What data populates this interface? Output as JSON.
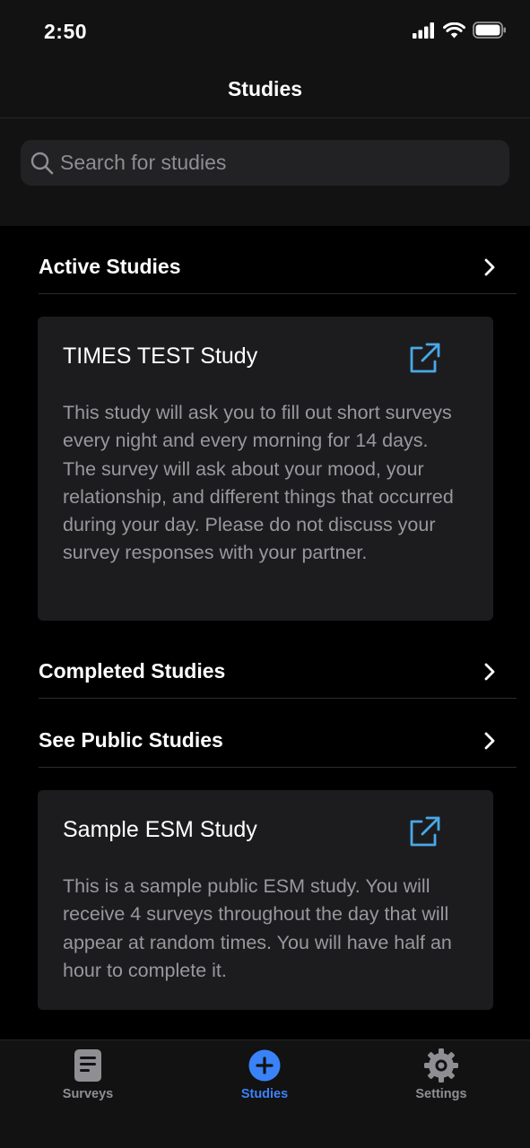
{
  "status_bar": {
    "time": "2:50"
  },
  "header": {
    "title": "Studies"
  },
  "search": {
    "placeholder": "Search for studies",
    "value": ""
  },
  "sections": {
    "active": {
      "label": "Active Studies"
    },
    "completed": {
      "label": "Completed Studies"
    },
    "public": {
      "label": "See Public Studies"
    }
  },
  "active_study": {
    "title": "TIMES TEST Study",
    "description": "This study will ask you to fill out short surveys every night and every morning for 14 days. The survey will ask about your mood, your relationship, and different things that occurred during your day. Please do not discuss your survey responses with your partner."
  },
  "public_study": {
    "title": "Sample ESM Study",
    "description": "This is a sample public ESM study. You will receive 4 surveys throughout the day that will appear at random times. You will have half an hour to complete it."
  },
  "tabs": [
    {
      "label": "Surveys",
      "icon": "document-icon",
      "active": false
    },
    {
      "label": "Studies",
      "icon": "plus-circle-icon",
      "active": true
    },
    {
      "label": "Settings",
      "icon": "gear-icon",
      "active": false
    }
  ],
  "colors": {
    "accent": "#3a82f7",
    "link_icon": "#4aa8e8",
    "background": "#000000",
    "card": "#1c1c1e"
  }
}
